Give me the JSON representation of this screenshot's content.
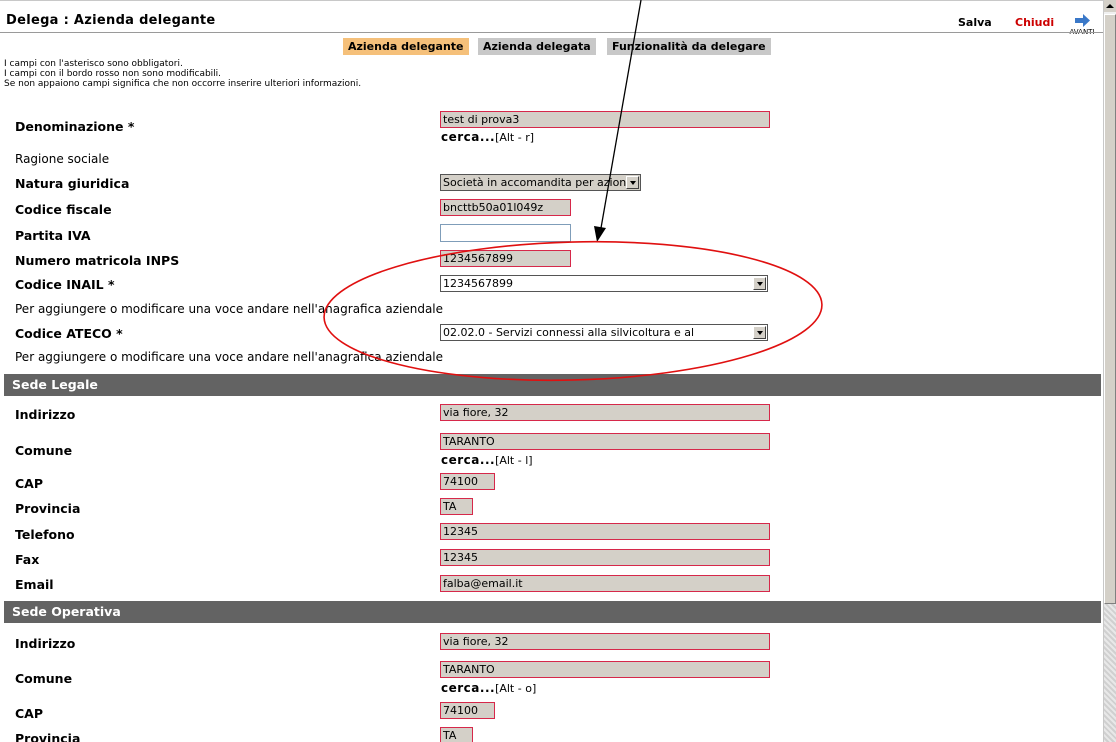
{
  "window": {
    "title": "Delega : Azienda delegante",
    "actions": {
      "save": "Salva",
      "close": "Chiudi",
      "next": "AVANTI"
    }
  },
  "tabs": [
    "Azienda delegante",
    "Azienda delegata",
    "Funzionalità da delegare"
  ],
  "notes": [
    "I campi con l'asterisco sono obbligatori.",
    "I campi con il bordo rosso non sono modificabili.",
    "Se non appaiono campi significa che non occorre inserire ulteriori informazioni."
  ],
  "company": {
    "denominazione": {
      "label": "Denominazione *",
      "value": "test di prova3"
    },
    "cerca1": {
      "link": "cerca...",
      "shortcut": "[Alt - r]"
    },
    "ragione_sociale": "Ragione sociale",
    "natura": {
      "label": "Natura giuridica",
      "value": "Società in accomandita per azioni"
    },
    "codice_fiscale": {
      "label": "Codice fiscale",
      "value": "bncttb50a01l049z"
    },
    "partita_iva": {
      "label": "Partita IVA",
      "value": ""
    },
    "inps": {
      "label": "Numero matricola INPS",
      "value": "1234567899"
    },
    "inail": {
      "label": "Codice INAIL *",
      "value": "1234567899"
    },
    "hint1": "Per aggiungere o modificare una voce andare nell'anagrafica aziendale",
    "ateco": {
      "label": "Codice ATECO *",
      "value": "02.02.0 - Servizi connessi alla silvicoltura e al"
    },
    "hint2": "Per aggiungere o modificare una voce andare nell'anagrafica aziendale"
  },
  "sede_legale": {
    "heading": "Sede Legale",
    "indirizzo": {
      "label": "Indirizzo",
      "value": "via fiore, 32"
    },
    "comune": {
      "label": "Comune",
      "value": "TARANTO"
    },
    "cerca": {
      "link": "cerca...",
      "shortcut": "[Alt - l]"
    },
    "cap": {
      "label": "CAP",
      "value": "74100"
    },
    "provincia": {
      "label": "Provincia",
      "value": "TA"
    },
    "telefono": {
      "label": "Telefono",
      "value": "12345"
    },
    "fax": {
      "label": "Fax",
      "value": "12345"
    },
    "email": {
      "label": "Email",
      "value": "falba@email.it"
    }
  },
  "sede_operativa": {
    "heading": "Sede Operativa",
    "indirizzo": {
      "label": "Indirizzo",
      "value": "via fiore, 32"
    },
    "comune": {
      "label": "Comune",
      "value": "TARANTO"
    },
    "cerca": {
      "link": "cerca...",
      "shortcut": "[Alt - o]"
    },
    "cap": {
      "label": "CAP",
      "value": "74100"
    },
    "provincia": {
      "label": "Provincia",
      "value": "TA"
    }
  },
  "colors": {
    "readonly_border": "#d6284a",
    "readonly_fill": "#d4d0c8",
    "section_bg": "#636363",
    "active_tab": "#f5c07a",
    "close_red": "#cc0000"
  }
}
